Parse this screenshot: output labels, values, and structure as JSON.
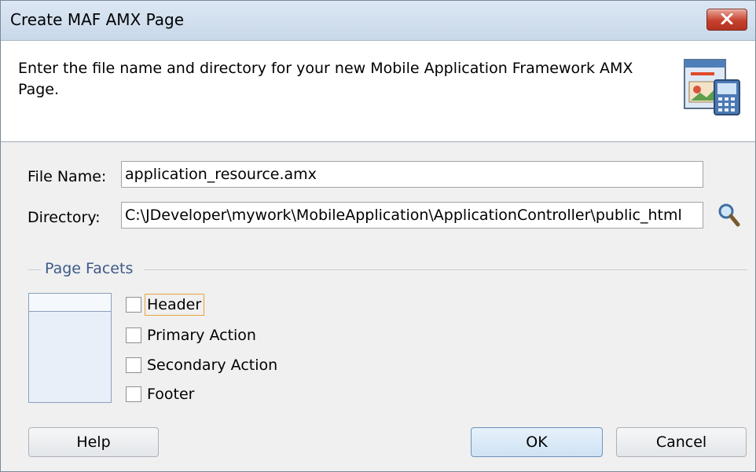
{
  "window": {
    "title": "Create MAF AMX Page"
  },
  "header": {
    "description": "Enter the file name and directory for your new Mobile Application Framework AMX Page."
  },
  "form": {
    "file_name_label": "File Name:",
    "file_name_value": "application_resource.amx",
    "directory_label": "Directory:",
    "directory_value": "C:\\JDeveloper\\mywork\\MobileApplication\\ApplicationController\\public_html"
  },
  "facets": {
    "group_title": "Page Facets",
    "items": [
      {
        "label": "Header",
        "checked": false,
        "focused": true
      },
      {
        "label": "Primary Action",
        "checked": false
      },
      {
        "label": "Secondary Action",
        "checked": false
      },
      {
        "label": "Footer",
        "checked": false
      }
    ]
  },
  "buttons": {
    "help": "Help",
    "ok": "OK",
    "cancel": "Cancel"
  },
  "icons": {
    "close": "close-icon",
    "page_wizard": "amx-page-icon",
    "browse": "magnifier-icon"
  },
  "colors": {
    "title_bar": "#c8d8ea",
    "close_button": "#c7412d",
    "group_title": "#3e5a8a",
    "focus_ring": "#e8a33a",
    "default_button": "#cfe2f4"
  }
}
